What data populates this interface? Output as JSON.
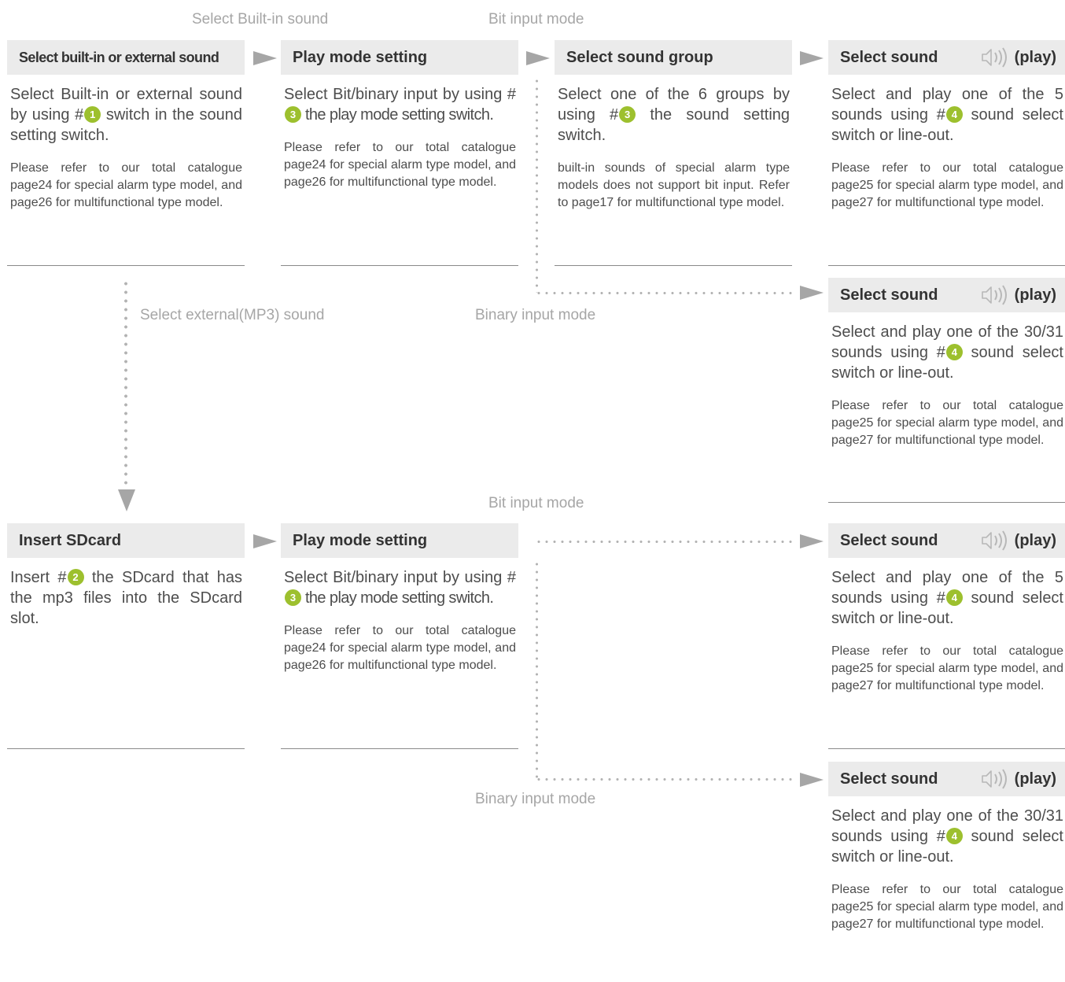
{
  "flow_labels": {
    "builtin": "Select Built-in sound",
    "bit_top": "Bit input mode",
    "external": "Select external(MP3) sound",
    "binary_mid": "Binary input mode",
    "bit_lower": "Bit input mode",
    "binary_bottom": "Binary input mode"
  },
  "colors": {
    "badge": "#9dc02e",
    "header_bg": "#ebebeb",
    "connector": "#a6a6a6"
  },
  "play_icon": "speaker-icon",
  "cards": {
    "select_source": {
      "title": "Select built-in or external sound",
      "main_before": "Select Built-in or external sound by using #",
      "badge": "1",
      "main_after": " switch in the sound setting switch.",
      "note": "Please refer to our total catalogue page24 for special alarm type model, and page26 for multifunctional type model."
    },
    "play_mode_top": {
      "title": "Play mode setting",
      "main_before": "Select Bit/binary input by using #",
      "badge": "3",
      "main_after": " the play mode setting switch.",
      "note": "Please refer to our total catalogue page24 for special alarm type model, and page26 for multifunctional type model."
    },
    "sound_group": {
      "title": "Select sound group",
      "main_before": "Select one of the 6 groups by using #",
      "badge": "3",
      "main_after": " the sound setting switch.",
      "note": "built-in sounds of special alarm type models does not support bit input. Refer to page17 for multifunctional type model."
    },
    "select_sound_1": {
      "title": "Select sound",
      "play": "(play)",
      "main_before": "Select and play one of the 5 sounds using #",
      "badge": "4",
      "main_after": " sound select switch or line-out.",
      "note": "Please refer to our total catalogue page25 for special alarm type model, and page27 for multifunctional type model."
    },
    "select_sound_2": {
      "title": "Select sound",
      "play": "(play)",
      "main_before": "Select and play one of the 30/31 sounds using #",
      "badge": "4",
      "main_after": " sound select switch or line-out.",
      "note": "Please refer to our total catalogue page25 for special alarm type model, and page27 for multifunctional type model."
    },
    "insert_sdcard": {
      "title": "Insert SDcard",
      "main_before": "Insert #",
      "badge": "2",
      "main_after": " the SDcard that has the mp3 files into the SDcard slot."
    },
    "play_mode_bottom": {
      "title": "Play mode setting",
      "main_before": "Select Bit/binary input by using #",
      "badge": "3",
      "main_after": " the play mode setting switch.",
      "note": "Please refer to our total catalogue page24 for special alarm type model, and page26 for multifunctional type model."
    },
    "select_sound_3": {
      "title": "Select sound",
      "play": "(play)",
      "main_before": "Select and play one of the 5 sounds using #",
      "badge": "4",
      "main_after": " sound select switch or line-out.",
      "note": "Please refer to our total catalogue page25 for special alarm type model, and page27 for multifunctional type model."
    },
    "select_sound_4": {
      "title": "Select sound",
      "play": "(play)",
      "main_before": "Select and play one of the 30/31 sounds using #",
      "badge": "4",
      "main_after": " sound select switch or line-out.",
      "note": "Please refer to our total catalogue page25 for special alarm type model, and page27 for multifunctional type model."
    }
  }
}
